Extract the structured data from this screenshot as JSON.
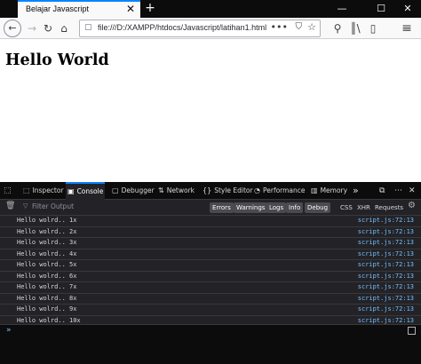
{
  "window": {
    "tab_title": "Belajar Javascript",
    "tab_close": "✕",
    "new_tab": "+",
    "minimize": "—",
    "maximize": "☐",
    "close": "✕"
  },
  "navbar": {
    "back_icon": "←",
    "forward_icon": "→",
    "reload_icon": "↻",
    "home_icon": "⌂",
    "url": "file:///D:/XAMPP/htdocs/Javascript/latihan1.html",
    "page_icon": "▢",
    "more_icon": "•••",
    "shield_icon": "⛉",
    "star_icon": "☆",
    "tools_icon": "⚲",
    "library_icon": "║\\",
    "sidebar_icon": "▯",
    "menu_icon": "≡"
  },
  "page": {
    "heading": "Hello World"
  },
  "devtools": {
    "tabs": [
      {
        "icon": "⬚",
        "label": "Inspector"
      },
      {
        "icon": "▣",
        "label": "Console"
      },
      {
        "icon": "▢",
        "label": "Debugger"
      },
      {
        "icon": "⇅",
        "label": "Network"
      },
      {
        "icon": "{}",
        "label": "Style Editor"
      },
      {
        "icon": "◔",
        "label": "Performance"
      },
      {
        "icon": "▥",
        "label": "Memory"
      }
    ],
    "overflow_icon": "»",
    "pick_icon": "⬚",
    "dock_icon": "⧉",
    "more_icon": "⋯",
    "close_icon": "✕",
    "filter": {
      "trash_icon": "🗑",
      "filter_icon": "▽",
      "placeholder": "Filter Output",
      "chips": [
        "Errors",
        "Warnings",
        "Logs",
        "Info",
        "Debug"
      ],
      "plain": [
        "CSS",
        "XHR",
        "Requests"
      ],
      "gear_icon": "⚙"
    },
    "logs": [
      {
        "msg": "Hello wolrd.. 1x",
        "src": "script.js:72:13"
      },
      {
        "msg": "Hello wolrd.. 2x",
        "src": "script.js:72:13"
      },
      {
        "msg": "Hello wolrd.. 3x",
        "src": "script.js:72:13"
      },
      {
        "msg": "Hello wolrd.. 4x",
        "src": "script.js:72:13"
      },
      {
        "msg": "Hello wolrd.. 5x",
        "src": "script.js:72:13"
      },
      {
        "msg": "Hello wolrd.. 6x",
        "src": "script.js:72:13"
      },
      {
        "msg": "Hello wolrd.. 7x",
        "src": "script.js:72:13"
      },
      {
        "msg": "Hello wolrd.. 8x",
        "src": "script.js:72:13"
      },
      {
        "msg": "Hello wolrd.. 9x",
        "src": "script.js:72:13"
      },
      {
        "msg": "Hello wolrd.. 10x",
        "src": "script.js:72:13"
      }
    ],
    "prompt_icon": "»"
  }
}
